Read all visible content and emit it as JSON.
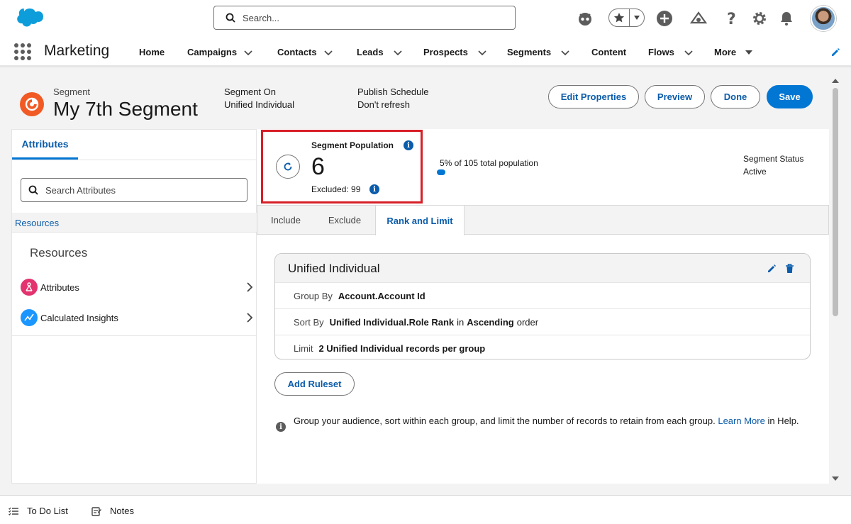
{
  "header": {
    "search_placeholder": "Search..."
  },
  "nav": {
    "app_name": "Marketing",
    "items": [
      {
        "label": "Home"
      },
      {
        "label": "Campaigns"
      },
      {
        "label": "Contacts"
      },
      {
        "label": "Leads"
      },
      {
        "label": "Prospects"
      },
      {
        "label": "Segments"
      },
      {
        "label": "Content"
      },
      {
        "label": "Flows"
      },
      {
        "label": "More"
      }
    ]
  },
  "page_header": {
    "object_type": "Segment",
    "title": "My 7th Segment",
    "segment_on_label": "Segment On",
    "segment_on_value": "Unified Individual",
    "publish_label": "Publish Schedule",
    "publish_value": "Don't refresh",
    "buttons": {
      "edit_properties": "Edit Properties",
      "preview": "Preview",
      "done": "Done",
      "save": "Save"
    }
  },
  "left_panel": {
    "tab": "Attributes",
    "search_placeholder": "Search Attributes",
    "breadcrumb": "Resources",
    "heading": "Resources",
    "items": [
      {
        "label": "Attributes",
        "icon": "attributes-icon"
      },
      {
        "label": "Calculated Insights",
        "icon": "calculated-insights-icon"
      }
    ]
  },
  "population": {
    "label": "Segment Population",
    "count": "6",
    "excluded": "Excluded: 99",
    "percent_text": "5% of 105 total population",
    "percent": 5,
    "status_label": "Segment Status",
    "status_value": "Active"
  },
  "tabs": [
    {
      "label": "Include"
    },
    {
      "label": "Exclude"
    },
    {
      "label": "Rank and Limit"
    }
  ],
  "rank_card": {
    "title": "Unified Individual",
    "group_by_label": "Group By",
    "group_by_value": "Account.Account Id",
    "sort_by_label": "Sort By",
    "sort_by_value": "Unified Individual.Role Rank",
    "sort_in": "in",
    "sort_order": "Ascending",
    "sort_suffix": "order",
    "limit_label": "Limit",
    "limit_value": "2 Unified Individual records per group"
  },
  "add_ruleset": "Add Ruleset",
  "help": {
    "text": "Group your audience, sort within each group, and limit the number of records to retain from each group.",
    "link": "Learn More",
    "suffix": "in Help."
  },
  "utility_bar": {
    "todo": "To Do List",
    "notes": "Notes"
  },
  "colors": {
    "brand": "#0176d3",
    "link": "#0b5cab",
    "highlight_border": "#d71f27",
    "segment_icon": "#f15a24"
  }
}
